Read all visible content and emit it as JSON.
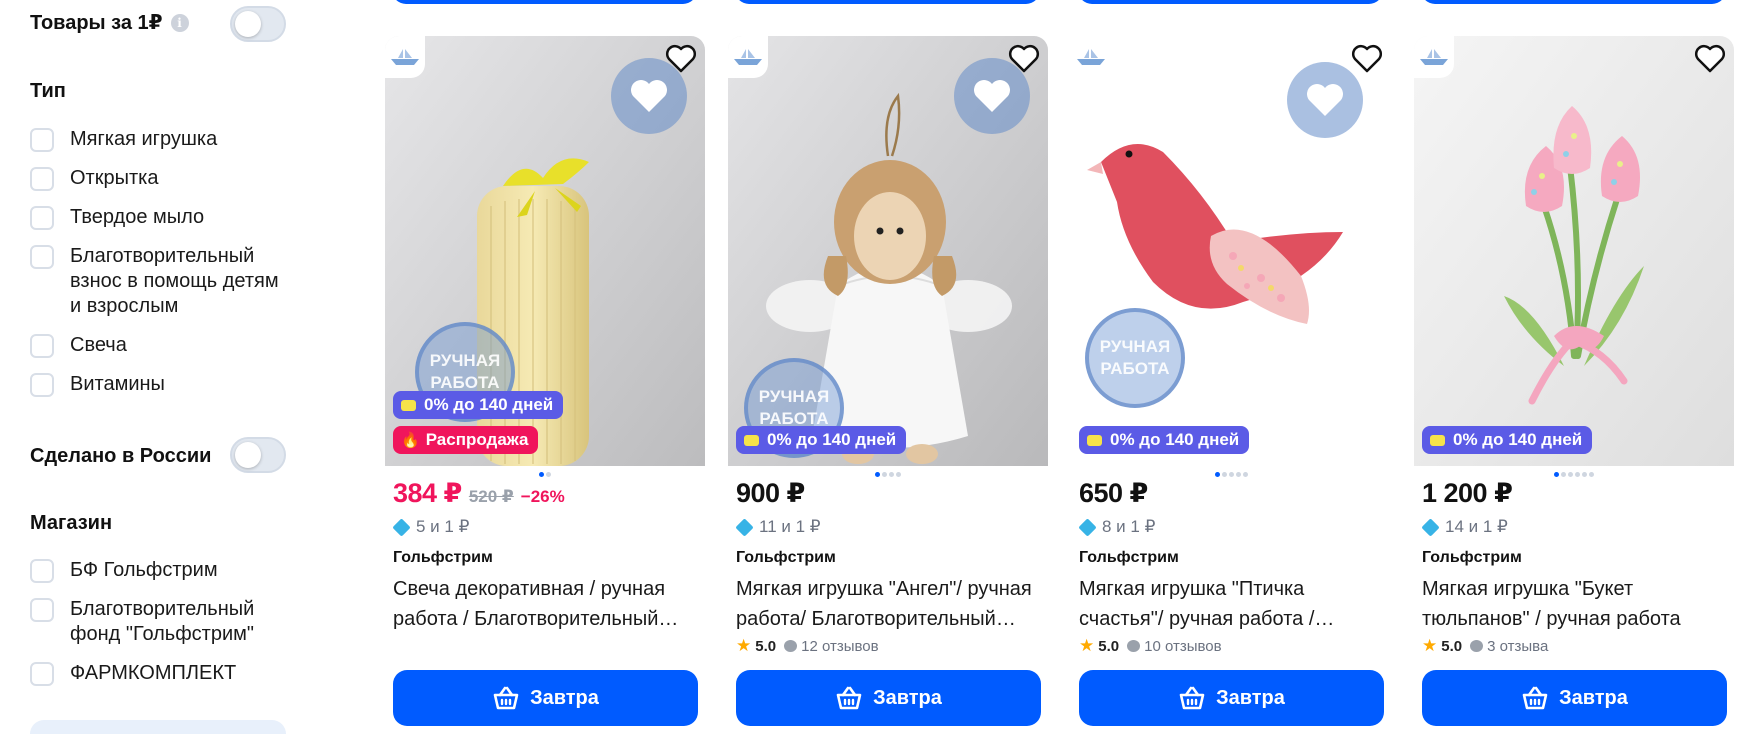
{
  "sidebar": {
    "goods_for_1r": {
      "label": "Товары за 1₽",
      "info_icon": "i",
      "enabled": false
    },
    "type": {
      "title": "Тип",
      "items": [
        "Мягкая игрушка",
        "Открытка",
        "Твердое мыло",
        "Благотворительный взнос в помощь детям и взрослым",
        "Свеча",
        "Витамины"
      ]
    },
    "made_in_russia": {
      "label": "Сделано в России",
      "enabled": false
    },
    "store": {
      "title": "Магазин",
      "items": [
        "БФ Гольфстрим",
        "Благотворительный фонд \"Гольфстрим\"",
        "ФАРМКОМПЛЕКТ"
      ]
    }
  },
  "colors": {
    "accent": "#005bff",
    "sale": "#f0155c",
    "credit_badge": "#5b5be6",
    "star": "#ffaa00",
    "points": "#37b3e6"
  },
  "products": [
    {
      "price": "384 ₽",
      "old_price": "520 ₽",
      "discount": "−26%",
      "points": "5 и 1 ₽",
      "seller": "Гольфстрим",
      "title": "Свеча декоративная / ручная работа / Благотворительный подарок",
      "badge_credit": "0% до 140 дней",
      "badge_sale": "Распродажа",
      "stamp_line1": "РУЧНАЯ",
      "stamp_line2": "РАБОТА",
      "rating": "",
      "reviews": "",
      "button": "Завтра"
    },
    {
      "price": "900 ₽",
      "points": "11 и 1 ₽",
      "seller": "Гольфстрим",
      "title": "Мягкая игрушка \"Ангел\"/ ручная работа/ Благотворительный подарок",
      "badge_credit": "0% до 140 дней",
      "stamp_line1": "РУЧНАЯ",
      "stamp_line2": "РАБОТА",
      "rating": "5.0",
      "reviews": "12 отзывов",
      "button": "Завтра"
    },
    {
      "price": "650 ₽",
      "points": "8 и 1 ₽",
      "seller": "Гольфстрим",
      "title": "Мягкая игрушка \"Птичка счастья\"/ ручная работа / Благотворительный подарок",
      "badge_credit": "0% до 140 дней",
      "stamp_line1": "РУЧНАЯ",
      "stamp_line2": "РАБОТА",
      "rating": "5.0",
      "reviews": "10 отзывов",
      "button": "Завтра"
    },
    {
      "price": "1 200 ₽",
      "points": "14 и 1 ₽",
      "seller": "Гольфстрим",
      "title": "Мягкая игрушка \"Букет тюльпанов\" / ручная работа",
      "badge_credit": "0% до 140 дней",
      "rating": "5.0",
      "reviews": "3 отзыва",
      "button": "Завтра"
    }
  ]
}
